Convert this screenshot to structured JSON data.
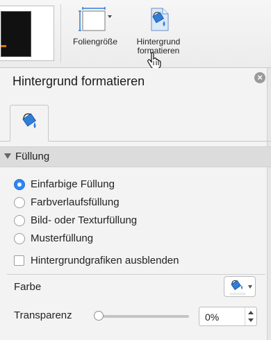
{
  "ribbon": {
    "slide_size_label": "Foliengröße",
    "background_label_line1": "Hintergrund",
    "background_label_line2": "formatieren"
  },
  "pane": {
    "title": "Hintergrund formatieren",
    "close_icon": "close-icon",
    "tab_icon": "paint-bucket-icon"
  },
  "fill_section": {
    "label": "Füllung",
    "options": [
      {
        "label": "Einfarbige Füllung",
        "selected": true
      },
      {
        "label": "Farbverlaufsfüllung",
        "selected": false
      },
      {
        "label": "Bild- oder Texturfüllung",
        "selected": false
      },
      {
        "label": "Musterfüllung",
        "selected": false
      }
    ],
    "hide_graphics_label": "Hintergrundgrafiken ausblenden",
    "hide_graphics_checked": false,
    "color_label": "Farbe",
    "color_value": "#ffffff",
    "transparency_label": "Transparenz",
    "transparency_value": "0%",
    "transparency_fraction": 0
  },
  "colors": {
    "accent_radio": "#2f86f6",
    "paint_bucket": "#2f7fd8"
  }
}
